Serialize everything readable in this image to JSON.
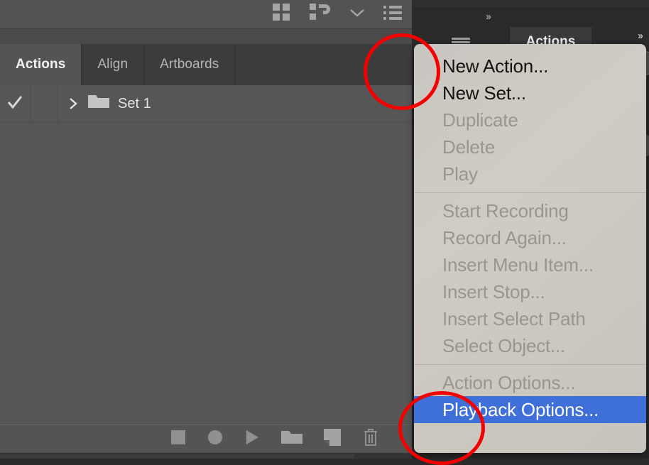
{
  "app": {
    "panel_title": "Actions"
  },
  "toolbar_icons": [
    {
      "name": "align-grid-icon",
      "glyph": "grid"
    },
    {
      "name": "pathfinder-icon",
      "glyph": "pathfinder"
    },
    {
      "name": "chevron-down-icon",
      "glyph": "chevron"
    },
    {
      "name": "list-icon",
      "glyph": "list"
    }
  ],
  "collapse": {
    "arrows": "››"
  },
  "tabs": [
    {
      "label": "Actions",
      "active": true
    },
    {
      "label": "Align",
      "active": false
    },
    {
      "label": "Artboards",
      "active": false
    }
  ],
  "panel_menu_button": {
    "name": "panel-menu-button",
    "tooltip": "Panel Menu"
  },
  "list": {
    "rows": [
      {
        "checked": "✓",
        "expand_arrow": "›",
        "icon": "folder-icon",
        "label": "Set 1"
      }
    ]
  },
  "bottom_toolbar": [
    {
      "name": "stop-playing-button",
      "glyph": "square"
    },
    {
      "name": "begin-recording-button",
      "glyph": "circle"
    },
    {
      "name": "play-current-selection-button",
      "glyph": "triangle"
    },
    {
      "name": "create-new-set-button",
      "glyph": "folder"
    },
    {
      "name": "create-new-action-button",
      "glyph": "page"
    },
    {
      "name": "delete-selection-button",
      "glyph": "trash"
    }
  ],
  "background_window": {
    "collapse_arrows": "››",
    "tab_label": "Actions"
  },
  "context_menu": {
    "groups": [
      {
        "items": [
          {
            "label": "New Action...",
            "enabled": true,
            "selected": false
          },
          {
            "label": "New Set...",
            "enabled": true,
            "selected": false
          },
          {
            "label": "Duplicate",
            "enabled": false,
            "selected": false
          },
          {
            "label": "Delete",
            "enabled": false,
            "selected": false
          },
          {
            "label": "Play",
            "enabled": false,
            "selected": false
          }
        ]
      },
      {
        "items": [
          {
            "label": "Start Recording",
            "enabled": false,
            "selected": false
          },
          {
            "label": "Record Again...",
            "enabled": false,
            "selected": false
          },
          {
            "label": "Insert Menu Item...",
            "enabled": false,
            "selected": false
          },
          {
            "label": "Insert Stop...",
            "enabled": false,
            "selected": false
          },
          {
            "label": "Insert Select Path",
            "enabled": false,
            "selected": false
          },
          {
            "label": "Select Object...",
            "enabled": false,
            "selected": false
          }
        ]
      },
      {
        "items": [
          {
            "label": "Action Options...",
            "enabled": false,
            "selected": false
          },
          {
            "label": "Playback Options...",
            "enabled": false,
            "selected": true
          }
        ]
      }
    ]
  },
  "annotations": {
    "color": "#f40000",
    "circles": [
      {
        "name": "highlight-panel-menu-button"
      },
      {
        "name": "highlight-playback-options-item"
      }
    ]
  }
}
